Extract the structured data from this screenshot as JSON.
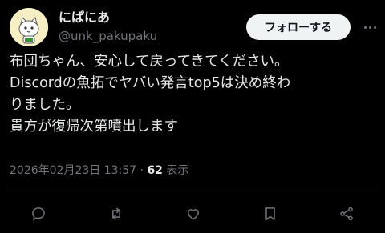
{
  "user": {
    "display_name": "にぱにあ",
    "handle": "@unk_pakupaku",
    "avatar_icon": "cartoon-cat-avatar"
  },
  "follow_button": {
    "label": "フォローする"
  },
  "more_icon": "more-dots-icon",
  "tweet": {
    "lines": [
      "布団ちゃん、安心して戻ってきてください。",
      "Discordの魚拓でヤバい発言top5は決め終わ",
      "りました。",
      "貴方が復帰次第噴出します"
    ]
  },
  "meta": {
    "date": "2026年02月23日",
    "time": "13:57",
    "separator": "·",
    "views_count": "62",
    "views_label": "表示"
  },
  "actions": [
    {
      "name": "reply-icon"
    },
    {
      "name": "retweet-icon"
    },
    {
      "name": "like-icon"
    },
    {
      "name": "bookmark-icon"
    },
    {
      "name": "share-icon"
    }
  ],
  "colors": {
    "background": "#000000",
    "text": "#e7e9ea",
    "secondary": "#71767b",
    "button_bg": "#eff3f4",
    "button_text": "#0f1419"
  }
}
